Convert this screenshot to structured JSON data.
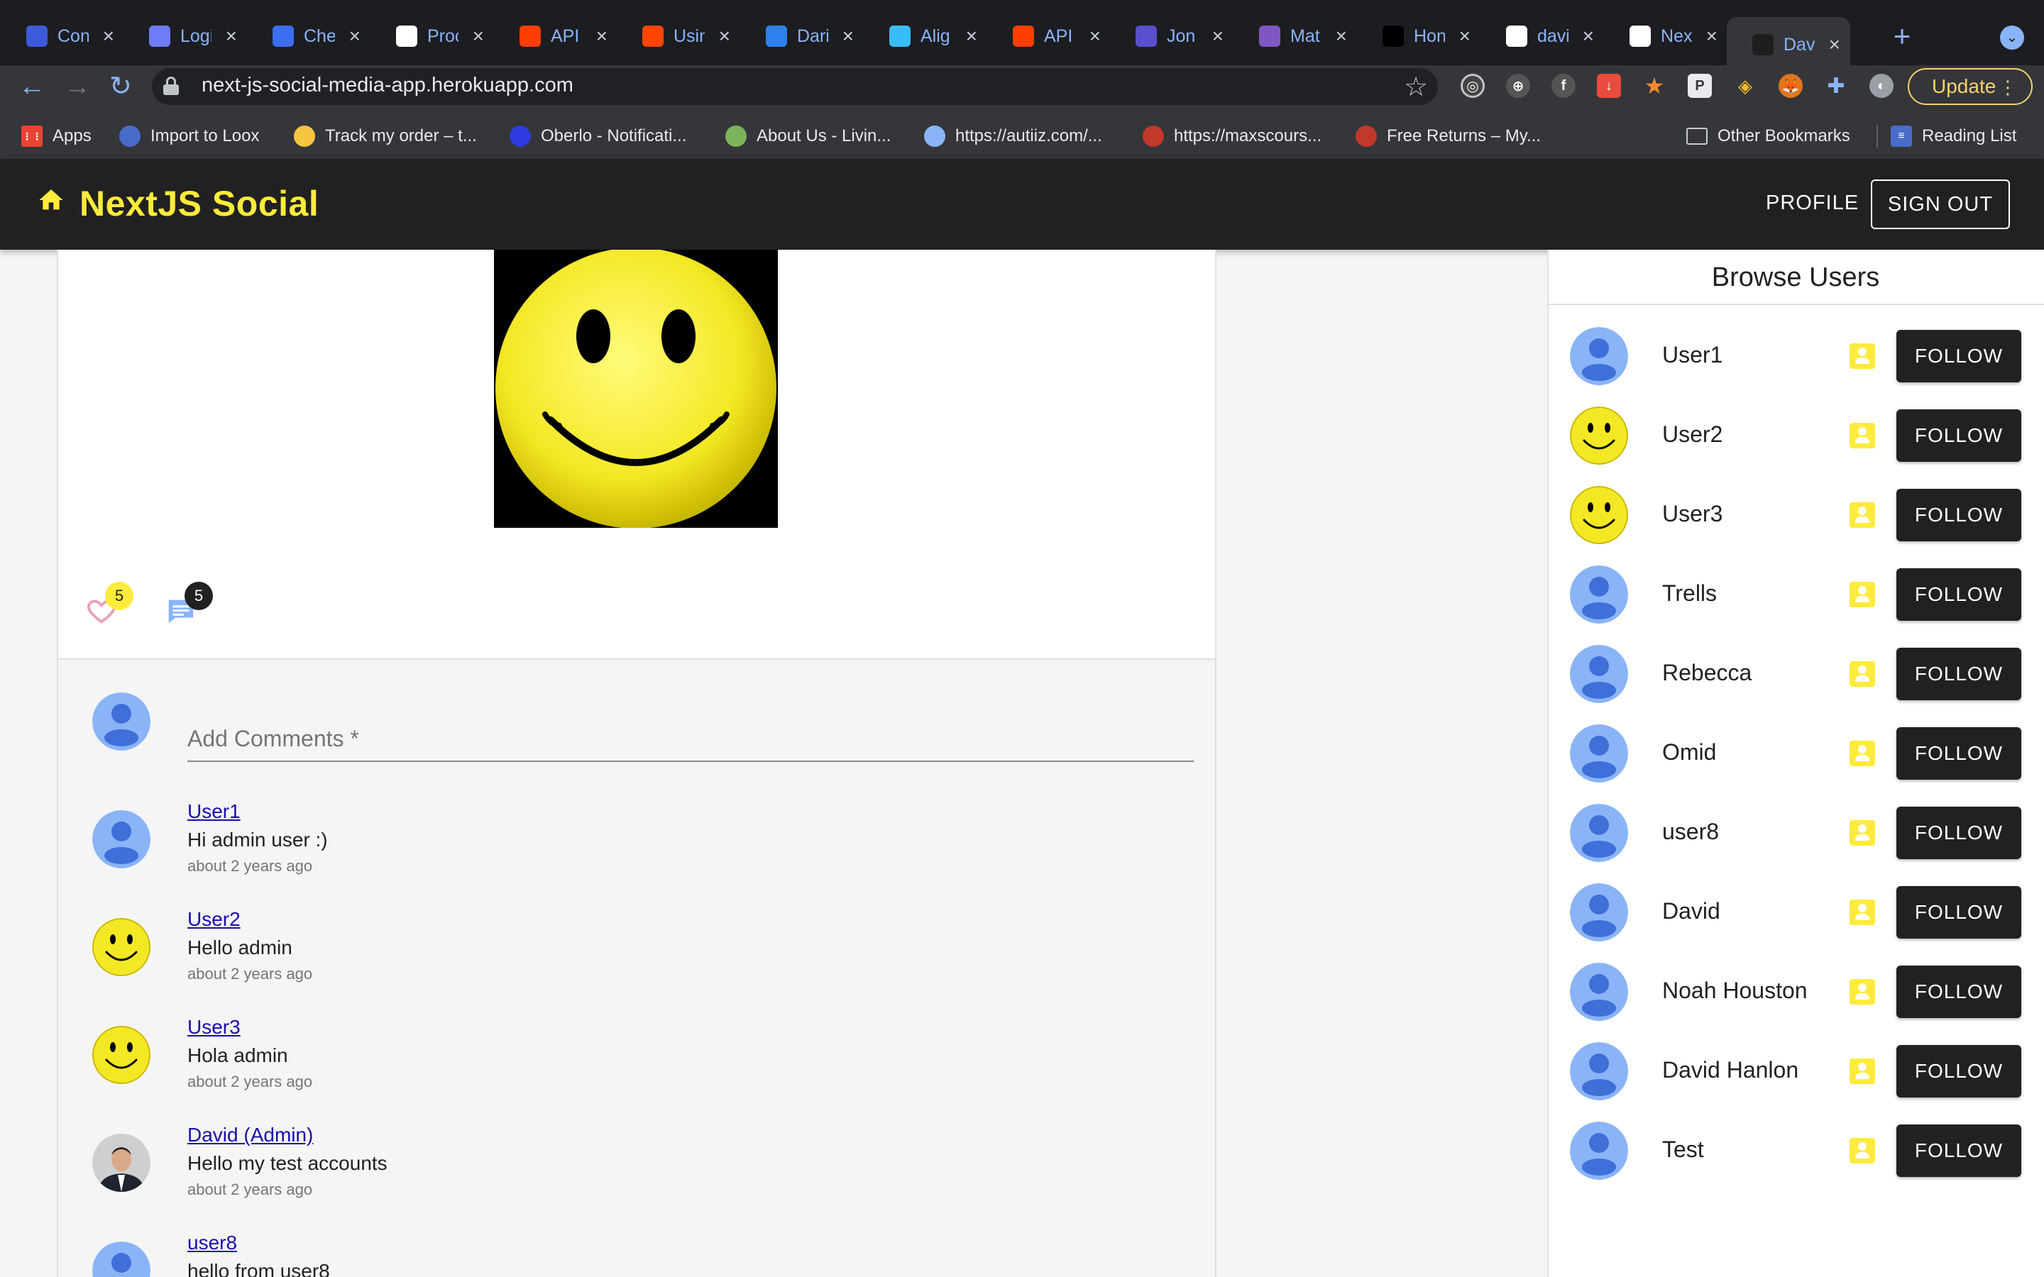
{
  "browser": {
    "tabs": [
      {
        "label": "Con",
        "icon": "dashboard-icon",
        "color": "#3c5bd9"
      },
      {
        "label": "Logi",
        "icon": "rocket-icon",
        "color": "#6f7bf7"
      },
      {
        "label": "Che",
        "icon": "at-sign-icon",
        "color": "#3d6df2"
      },
      {
        "label": "Proc",
        "icon": "hummingbird-icon",
        "color": "#ffffff"
      },
      {
        "label": "API",
        "icon": "svelte-icon",
        "color": "#ff3e00"
      },
      {
        "label": "Usin",
        "icon": "reddit-icon",
        "color": "#ff4500"
      },
      {
        "label": "Dari",
        "icon": "dp-icon",
        "color": "#2f80ed"
      },
      {
        "label": "Alig",
        "icon": "tailwind-icon",
        "color": "#38bdf8"
      },
      {
        "label": "API",
        "icon": "svelte-icon",
        "color": "#ff3e00"
      },
      {
        "label": "Jon",
        "icon": "document-icon",
        "color": "#5a4fcf"
      },
      {
        "label": "Mat",
        "icon": "chart-icon",
        "color": "#7e57c2"
      },
      {
        "label": "Hon",
        "icon": "d-logo-icon",
        "color": "#000000"
      },
      {
        "label": "davi",
        "icon": "github-icon",
        "color": "#ffffff"
      },
      {
        "label": "Nex",
        "icon": "page-icon",
        "color": "#ffffff"
      },
      {
        "label": "Dav",
        "icon": "phone-icon",
        "color": "#1e1e1e"
      }
    ],
    "url": "next-js-social-media-app.herokuapp.com",
    "update_label": "Update",
    "bookmarks": [
      {
        "label": "Apps",
        "icon": "apps-grid-icon"
      },
      {
        "label": "Import to Loox",
        "icon": "globe-icon"
      },
      {
        "label": "Track my order – t...",
        "icon": "clock-icon"
      },
      {
        "label": "Oberlo - Notificati...",
        "icon": "oberlo-icon"
      },
      {
        "label": "About Us - Livin...",
        "icon": "shopify-icon"
      },
      {
        "label": "https://autiiz.com/...",
        "icon": "triangle-icon"
      },
      {
        "label": "https://maxscours...",
        "icon": "x-logo-icon"
      },
      {
        "label": "Free Returns – My...",
        "icon": "shoe-icon"
      }
    ],
    "other_bookmarks": "Other Bookmarks",
    "reading_list": "Reading List"
  },
  "app": {
    "brand": "NextJS Social",
    "nav_profile": "PROFILE",
    "nav_signout": "SIGN OUT",
    "post": {
      "like_count": "5",
      "comment_count": "5"
    },
    "comment_placeholder": "Add Comments *",
    "comments": [
      {
        "author": "User1",
        "text": "Hi admin user :)",
        "time": "about 2 years ago",
        "avatar": "default"
      },
      {
        "author": "User2",
        "text": "Hello admin",
        "time": "about 2 years ago",
        "avatar": "smiley"
      },
      {
        "author": "User3",
        "text": "Hola admin",
        "time": "about 2 years ago",
        "avatar": "smiley"
      },
      {
        "author": "David (Admin)",
        "text": "Hello my test accounts",
        "time": "about 2 years ago",
        "avatar": "photo"
      },
      {
        "author": "user8",
        "text": "hello from user8",
        "time": "",
        "avatar": "default"
      }
    ],
    "browse_title": "Browse Users",
    "follow_label": "FOLLOW",
    "users": [
      {
        "name": "User1",
        "avatar": "default"
      },
      {
        "name": "User2",
        "avatar": "smiley"
      },
      {
        "name": "User3",
        "avatar": "smiley"
      },
      {
        "name": "Trells",
        "avatar": "default"
      },
      {
        "name": "Rebecca",
        "avatar": "default"
      },
      {
        "name": "Omid",
        "avatar": "default"
      },
      {
        "name": "user8",
        "avatar": "default"
      },
      {
        "name": "David",
        "avatar": "default"
      },
      {
        "name": "Noah Houston",
        "avatar": "default"
      },
      {
        "name": "David Hanlon",
        "avatar": "default"
      },
      {
        "name": "Test",
        "avatar": "default"
      }
    ]
  },
  "colors": {
    "accent_yellow": "#ffeb3b",
    "appbar": "#212121",
    "link_blue": "#1a0dab",
    "avatar_blue": "#8ab4f8"
  }
}
